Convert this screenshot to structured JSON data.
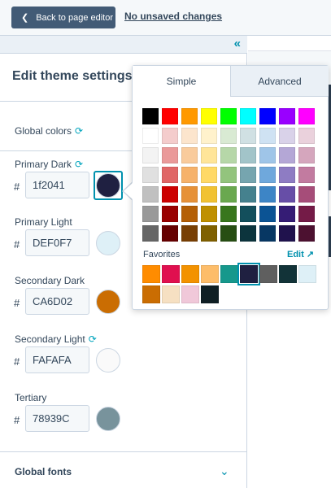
{
  "topbar": {
    "back_label": "Back to page editor",
    "unsaved_label": "No unsaved changes"
  },
  "sidebar": {
    "title": "Edit theme settings",
    "global_colors_label": "Global colors",
    "global_fonts_label": "Global fonts",
    "colors": [
      {
        "label": "Primary Dark",
        "value": "1f2041",
        "hex": "#1f2041",
        "synced": true,
        "active": true
      },
      {
        "label": "Primary Light",
        "value": "DEF0F7",
        "hex": "#DEF0F7",
        "synced": false,
        "active": false
      },
      {
        "label": "Secondary Dark",
        "value": "CA6D02",
        "hex": "#CA6D02",
        "synced": false,
        "active": false
      },
      {
        "label": "Secondary Light",
        "value": "FAFAFA",
        "hex": "#FAFAFA",
        "synced": true,
        "active": false
      },
      {
        "label": "Tertiary",
        "value": "78939C",
        "hex": "#78939C",
        "synced": false,
        "active": false
      }
    ],
    "hash_symbol": "#"
  },
  "picker": {
    "tabs": [
      "Simple",
      "Advanced"
    ],
    "active_tab": "Simple",
    "favorites_label": "Favorites",
    "edit_label": "Edit",
    "palette": [
      [
        "#000000",
        "#ff0000",
        "#ff9900",
        "#ffff00",
        "#00ff00",
        "#00ffff",
        "#0000ff",
        "#9900ff",
        "#ff00ff"
      ],
      [
        "#ffffff",
        "#f4cccc",
        "#fce5cd",
        "#fff2cc",
        "#d9ead3",
        "#d0e0e3",
        "#cfe2f3",
        "#d9d2e9",
        "#ead1dc"
      ],
      [
        "#f3f3f3",
        "#ea9999",
        "#f9cb9c",
        "#ffe599",
        "#b6d7a8",
        "#a2c4c9",
        "#9fc5e8",
        "#b4a7d6",
        "#d5a6bd"
      ],
      [
        "#e0e0e0",
        "#e06666",
        "#f6b26b",
        "#ffd966",
        "#93c47d",
        "#76a5af",
        "#6fa8dc",
        "#8e7cc3",
        "#c27ba0"
      ],
      [
        "#c0c0c0",
        "#cc0000",
        "#e69138",
        "#f1c232",
        "#6aa84f",
        "#45818e",
        "#3d85c6",
        "#674ea7",
        "#a64d79"
      ],
      [
        "#999999",
        "#990000",
        "#b45f06",
        "#bf9000",
        "#38761d",
        "#134f5c",
        "#0b5394",
        "#351c75",
        "#741b47"
      ],
      [
        "#666666",
        "#660000",
        "#783f04",
        "#7f6000",
        "#274e13",
        "#0c343d",
        "#073763",
        "#20124d",
        "#4c1130"
      ]
    ],
    "favorites": [
      {
        "hex": "#ff8c00",
        "selected": false
      },
      {
        "hex": "#e0104f",
        "selected": false
      },
      {
        "hex": "#f39200",
        "selected": false
      },
      {
        "hex": "#fdbd6a",
        "selected": false
      },
      {
        "hex": "#16988c",
        "selected": false
      },
      {
        "hex": "#1f2041",
        "selected": true
      },
      {
        "hex": "#5f5f5f",
        "selected": false
      },
      {
        "hex": "#123338",
        "selected": false
      },
      {
        "hex": "#def0f7",
        "selected": false
      },
      {
        "hex": "#ca6d02",
        "selected": false
      },
      {
        "hex": "#f6e0c2",
        "selected": false
      },
      {
        "hex": "#f0c8d9",
        "selected": false
      },
      {
        "hex": "#0f1f24",
        "selected": false
      }
    ]
  }
}
